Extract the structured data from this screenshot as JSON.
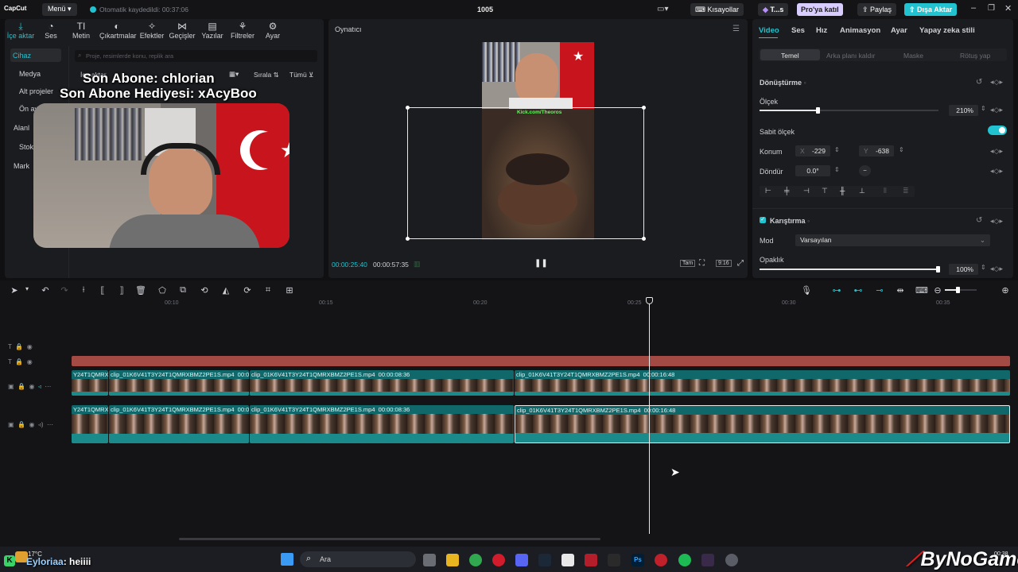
{
  "topbar": {
    "logo": "CapCut",
    "menu_label": "Menü",
    "autosave": "Otomatik kaydedildi: 00:37:06",
    "project_title": "1005",
    "shortcuts_label": "Kısayollar",
    "pro_label": "T...s",
    "join_pro_label": "Pro'ya katıl",
    "share_label": "Paylaş",
    "export_label": "Dışa Aktar"
  },
  "media_toolbar": [
    {
      "label": "İçe aktar",
      "icon": "import-icon"
    },
    {
      "label": "Ses",
      "icon": "audio-icon"
    },
    {
      "label": "Metin",
      "icon": "text-icon"
    },
    {
      "label": "Çıkartmalar",
      "icon": "sticker-icon"
    },
    {
      "label": "Efektler",
      "icon": "effects-icon"
    },
    {
      "label": "Geçişler",
      "icon": "transitions-icon"
    },
    {
      "label": "Yazılar",
      "icon": "captions-icon"
    },
    {
      "label": "Filtreler",
      "icon": "filters-icon"
    },
    {
      "label": "Ayar",
      "icon": "adjust-icon"
    }
  ],
  "media_nav": [
    "Cihaz",
    "Medya",
    "Alt projeler",
    "Ön ayar",
    "Alanl",
    "Stok",
    "Mark"
  ],
  "media_search_placeholder": "Proje, resimlerde konu, replik ara",
  "media_sort_label": "Sırala",
  "media_filter_label": "Tümü",
  "media_import_label": "İçe aktar",
  "overlay": {
    "line1": "Son Abone: chlorian",
    "line2": "Son Abone Hediyesi: xAcyBoo"
  },
  "player": {
    "title": "Oynatıcı",
    "current_time": "00:00:25:40",
    "total_time": "00:00:57:35",
    "full_label": "Tam",
    "ratio_label": "9:16",
    "stream_text": "Kick.com/Theoros"
  },
  "props": {
    "tabs": [
      "Video",
      "Ses",
      "Hız",
      "Animasyon",
      "Ayar",
      "Yapay zeka stili"
    ],
    "subtabs": [
      "Temel",
      "Arka planı kaldır",
      "Maske",
      "Rötuş yap"
    ],
    "transform_title": "Dönüştürme",
    "scale_label": "Ölçek",
    "scale_value": "210%",
    "scale_fraction": 0.33,
    "uniform_scale_label": "Sabit ölçek",
    "position_label": "Konum",
    "x_label": "X",
    "x_value": "-229",
    "y_label": "Y",
    "y_value": "-638",
    "rotate_label": "Döndür",
    "rotate_value": "0.0°",
    "blend_title": "Karıştırma",
    "mode_label": "Mod",
    "mode_value": "Varsayılan",
    "opacity_label": "Opaklık",
    "opacity_value": "100%",
    "opacity_fraction": 1.0
  },
  "timeline": {
    "ruler": [
      "00:10",
      "00:15",
      "00:20",
      "00:25",
      "00:30",
      "00:35"
    ],
    "clip_prefix": "Y24T1QMRXI",
    "clip_name": "clip_01K6V41T3Y24T1QMRXBMZ2PE1S.mp4",
    "clip_dur_a": "00:0(",
    "clip_dur_b": "00:00:08:36",
    "clip_dur_c": "00:00:16:48"
  },
  "taskbar": {
    "weather": "17°C",
    "search_label": "Ara",
    "time": "00:38",
    "chat_user": "Eyloriaa",
    "chat_message": ": heiiii",
    "brand": "ByNoGame"
  }
}
